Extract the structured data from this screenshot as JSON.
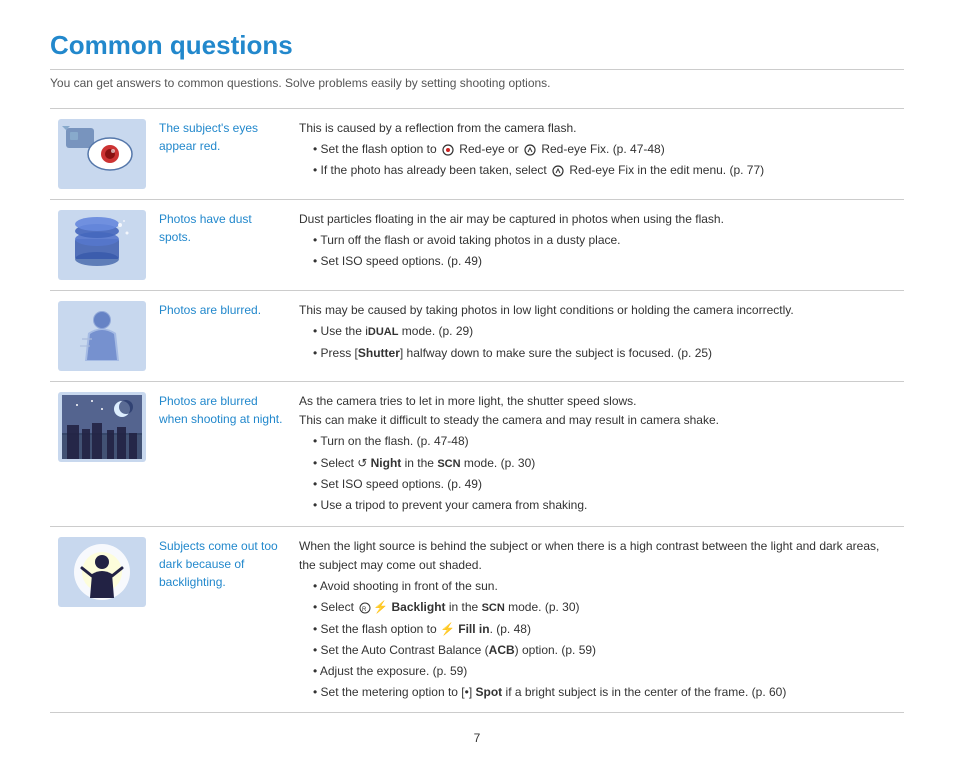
{
  "page": {
    "title": "Common questions",
    "subtitle": "You can get answers to common questions. Solve problems easily by setting shooting options.",
    "page_number": "7"
  },
  "rows": [
    {
      "id": "red-eye",
      "label": "The subject's eyes appear red.",
      "desc_intro": "This is caused by a reflection from the camera flash.",
      "bullets": [
        "Set the flash option to ◉ Red-eye or ◉ Red-eye Fix. (p. 47-48)",
        "If the photo has already been taken, select ◉ Red-eye Fix in the edit menu. (p. 77)"
      ]
    },
    {
      "id": "dust-spots",
      "label": "Photos have dust spots.",
      "desc_intro": "Dust particles floating in the air may be captured in photos when using the flash.",
      "bullets": [
        "Turn off the flash or avoid taking photos in a dusty place.",
        "Set ISO speed options. (p. 49)"
      ]
    },
    {
      "id": "blurred",
      "label": "Photos are blurred.",
      "desc_intro": "This may be caused by taking photos in low light conditions or holding the camera incorrectly.",
      "bullets": [
        "Use the ⓘDUAL mode. (p. 29)",
        "Press [Shutter] halfway down to make sure the subject is focused. (p. 25)"
      ]
    },
    {
      "id": "blurred-night",
      "label": "Photos are blurred when shooting at night.",
      "desc_intro": "As the camera tries to let in more light, the shutter speed slows.\nThis can make it difficult to steady the camera and may result in camera shake.",
      "bullets": [
        "Turn on the flash. (p. 47-48)",
        "Select ↺ Night in the SCN mode. (p. 30)",
        "Set ISO speed options. (p. 49)",
        "Use a tripod to prevent your camera from shaking."
      ]
    },
    {
      "id": "backlight",
      "label": "Subjects come out too dark because of backlighting.",
      "desc_intro": "When the light source is behind the subject or when there is a high contrast between the light and dark areas, the subject may come out shaded.",
      "bullets": [
        "Avoid shooting in front of the sun.",
        "Select Ⓡ⚡ Backlight in the SCN mode. (p. 30)",
        "Set the flash option to ⚡ Fill in. (p. 48)",
        "Set the Auto Contrast Balance (ACB) option. (p. 59)",
        "Adjust the exposure. (p. 59)",
        "Set the metering option to [•] Spot if a bright subject is in the center of the frame. (p. 60)"
      ]
    }
  ]
}
